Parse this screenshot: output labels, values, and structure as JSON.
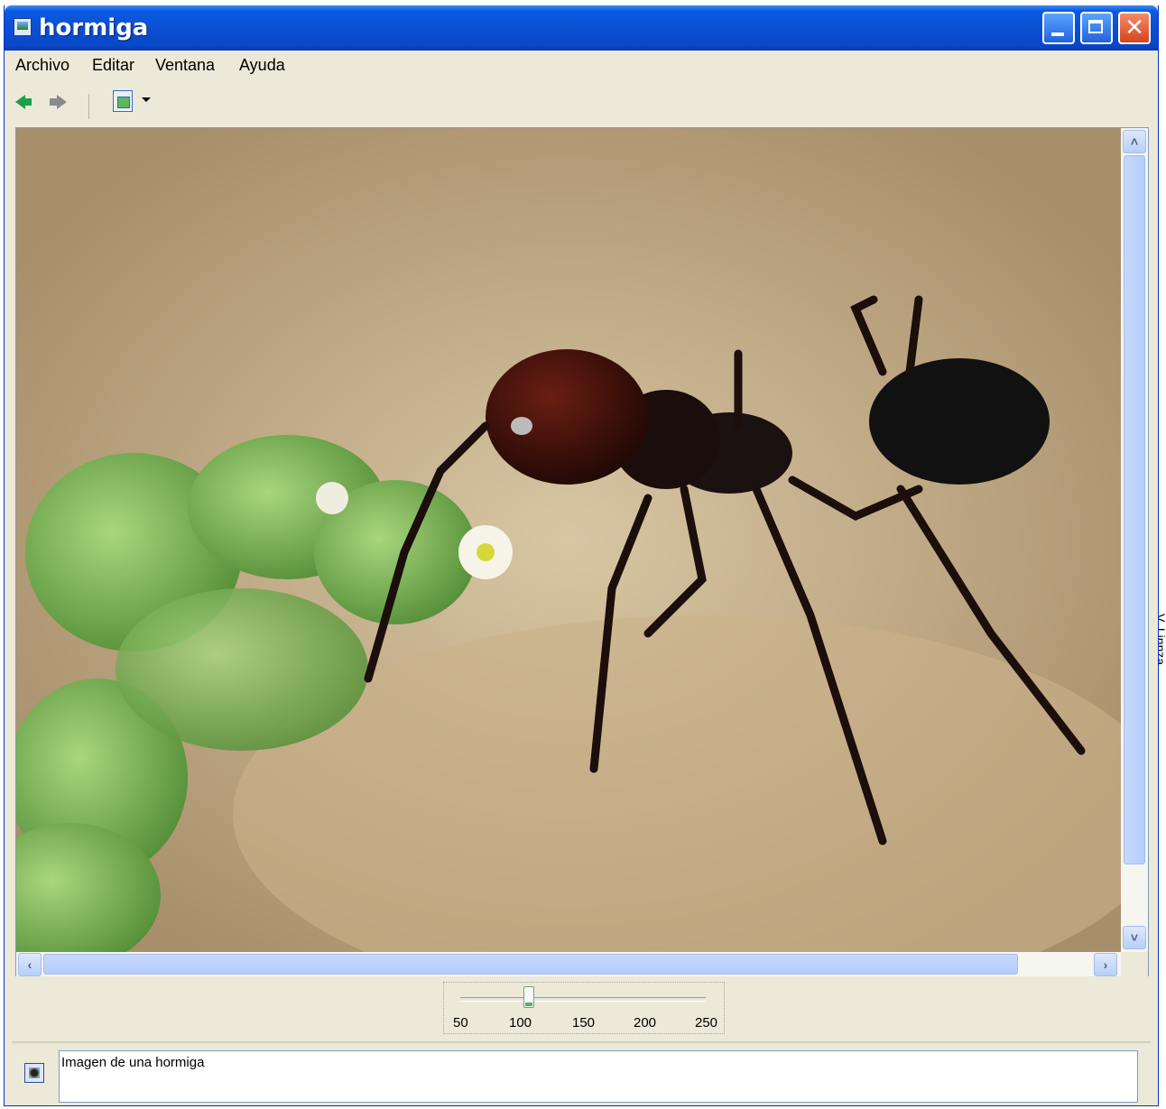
{
  "window": {
    "title": "hormiga"
  },
  "titlebar": {
    "close_label": "✕"
  },
  "menu": {
    "items": [
      "Archivo",
      "Editar",
      "Ventana",
      "Ayuda"
    ]
  },
  "toolbar": {
    "icons": [
      "back-arrow-icon",
      "forward-arrow-icon",
      "view-mode-icon",
      "dropdown-caret-icon"
    ]
  },
  "zoom": {
    "ticks": [
      "50",
      "100",
      "150",
      "200",
      "250"
    ],
    "value": 100,
    "min": 50,
    "max": 250
  },
  "caption": {
    "text": "Imagen de una hormiga"
  },
  "side": {
    "text": "V. Linnza"
  },
  "colors": {
    "titlebar": "#0A4FD3",
    "window_bg": "#ECE9D8",
    "scrollbar": "#C6D8FB",
    "close": "#D5441C"
  }
}
